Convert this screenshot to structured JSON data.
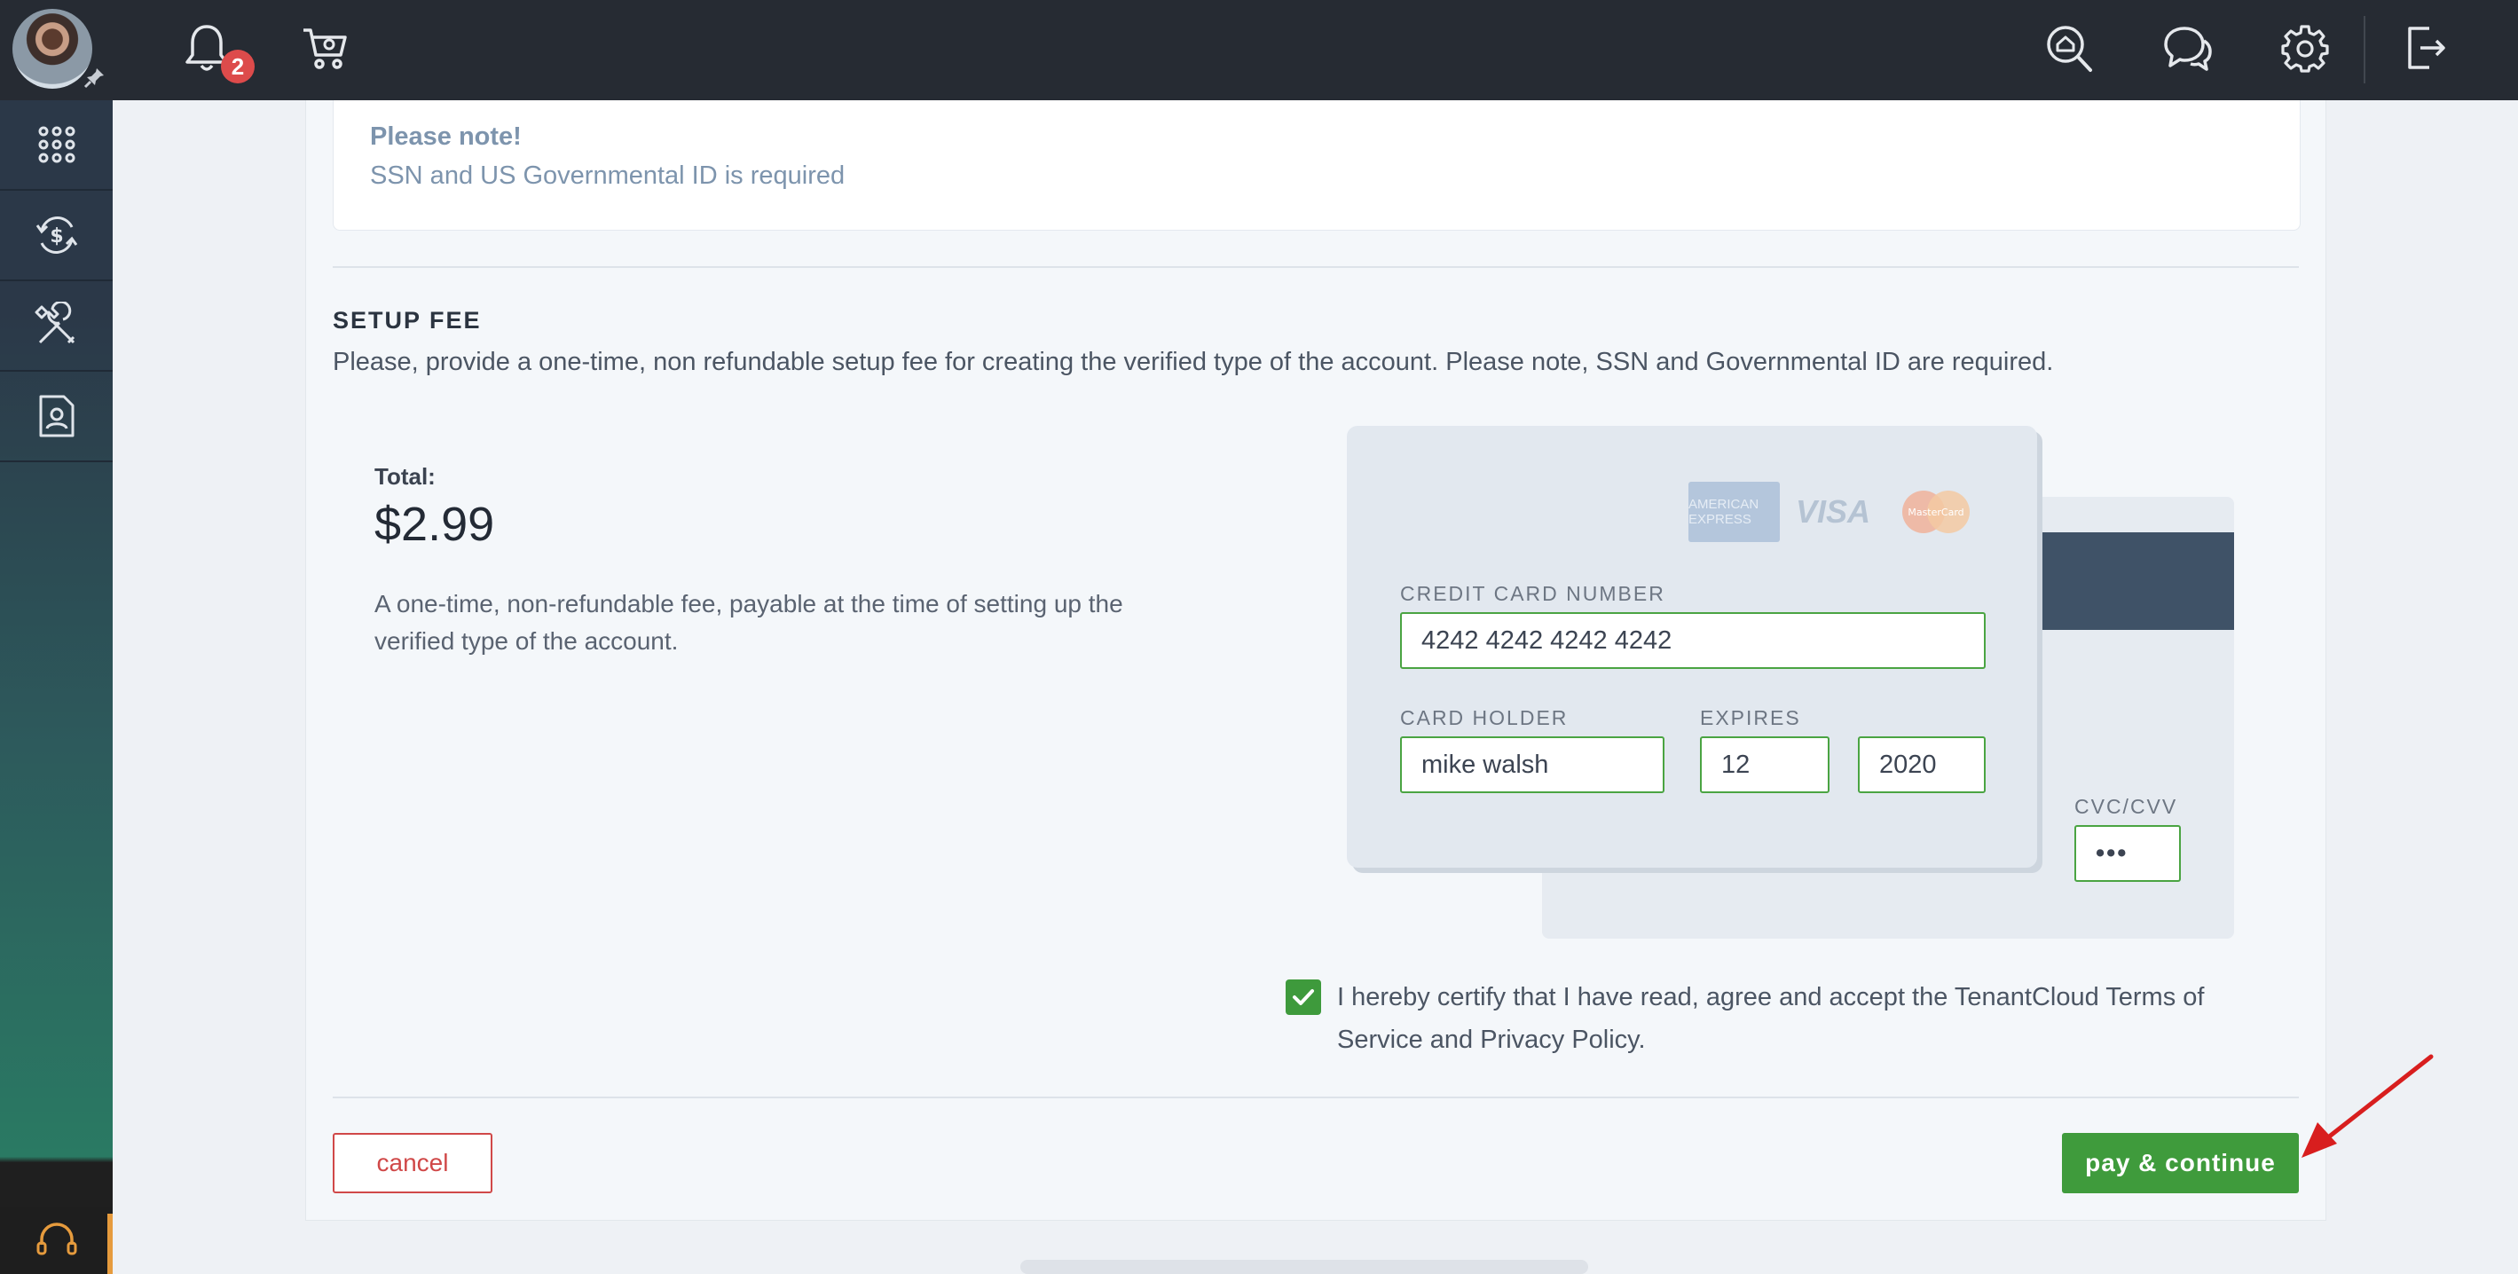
{
  "topbar": {
    "notifications_count": "2"
  },
  "note": {
    "title": "Please note!",
    "text": "SSN and US Governmental ID is required"
  },
  "setup_fee": {
    "title": "SETUP FEE",
    "description": "Please, provide a one-time, non refundable setup fee for creating the verified type of the account. Please note, SSN and Governmental ID are required.",
    "total_label": "Total:",
    "total_amount": "$2.99",
    "total_description": "A one-time, non-refundable fee, payable at the time of setting up the verified type of the account."
  },
  "card_form": {
    "brands": [
      "AMERICAN EXPRESS",
      "VISA",
      "MasterCard"
    ],
    "number_label": "CREDIT CARD NUMBER",
    "number_value": "4242 4242 4242 4242",
    "holder_label": "CARD HOLDER",
    "holder_value": "mike walsh",
    "expires_label": "EXPIRES",
    "expires_month": "12",
    "expires_year": "2020",
    "cvc_label": "CVC/CVV",
    "cvc_value": "•••"
  },
  "certify": {
    "checked": true,
    "text": "I hereby certify that I have read, agree and accept the TenantCloud Terms of Service and Privacy Policy."
  },
  "actions": {
    "cancel_label": "cancel",
    "pay_label": "pay & continue"
  },
  "colors": {
    "topbar": "#262b33",
    "accent_green": "#3f9b3c",
    "danger_red": "#d04848",
    "badge_red": "#dd4b4b"
  },
  "icons": [
    "bell-icon",
    "cart-icon",
    "search-home-icon",
    "chat-icon",
    "gear-icon",
    "logout-icon",
    "apps-grid-icon",
    "payments-icon",
    "tools-icon",
    "contact-document-icon",
    "headset-icon"
  ]
}
